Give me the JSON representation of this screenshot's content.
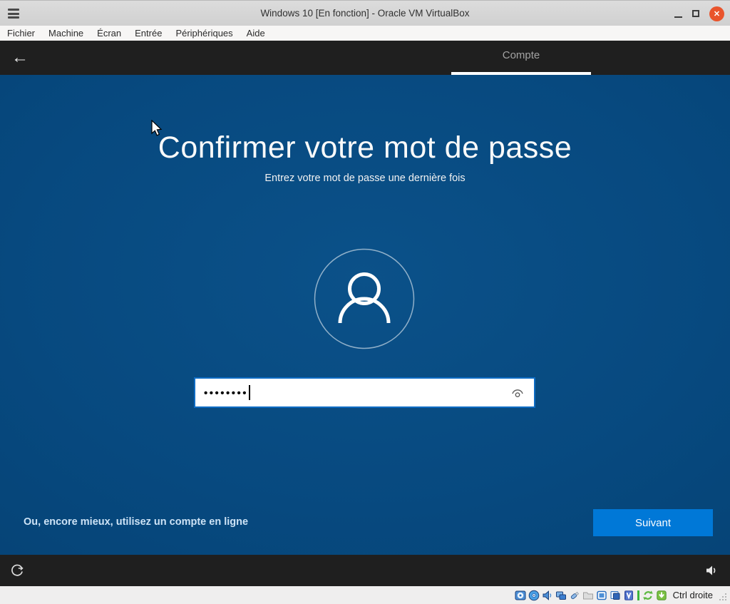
{
  "titlebar": {
    "title": "Windows 10 [En fonction] - Oracle VM VirtualBox",
    "close_glyph": "✕"
  },
  "menubar": {
    "items": [
      "Fichier",
      "Machine",
      "Écran",
      "Entrée",
      "Périphériques",
      "Aide"
    ]
  },
  "oobe_header": {
    "back_arrow": "←",
    "tab_label": "Compte"
  },
  "content": {
    "title": "Confirmer votre mot de passe",
    "subtitle": "Entrez votre mot de passe une dernière fois",
    "password_masked": "••••••••",
    "password_dot_count": 8,
    "online_account_link": "Ou, encore mieux, utilisez un compte en ligne",
    "next_button": "Suivant"
  },
  "statusbar": {
    "host_key": "Ctrl droite",
    "icons": [
      {
        "name": "hard-disks-icon"
      },
      {
        "name": "optical-drives-icon"
      },
      {
        "name": "audio-icon"
      },
      {
        "name": "network-icon"
      },
      {
        "name": "usb-icon"
      },
      {
        "name": "shared-folders-icon"
      },
      {
        "name": "display-icon"
      },
      {
        "name": "recording-icon"
      },
      {
        "name": "features-icon"
      },
      {
        "name": "mouse-integration-icon"
      },
      {
        "name": "keyboard-indicator-icon"
      }
    ]
  },
  "colors": {
    "oobe_blue": "#07497f",
    "accent_button": "#0078d7",
    "field_focus_border": "#0e6cc4",
    "dark_bar": "#1f1f1f",
    "close_button": "#e9542c",
    "titlebar_gray": "#d6d6d6",
    "statusbar_gray": "#efeeee"
  }
}
